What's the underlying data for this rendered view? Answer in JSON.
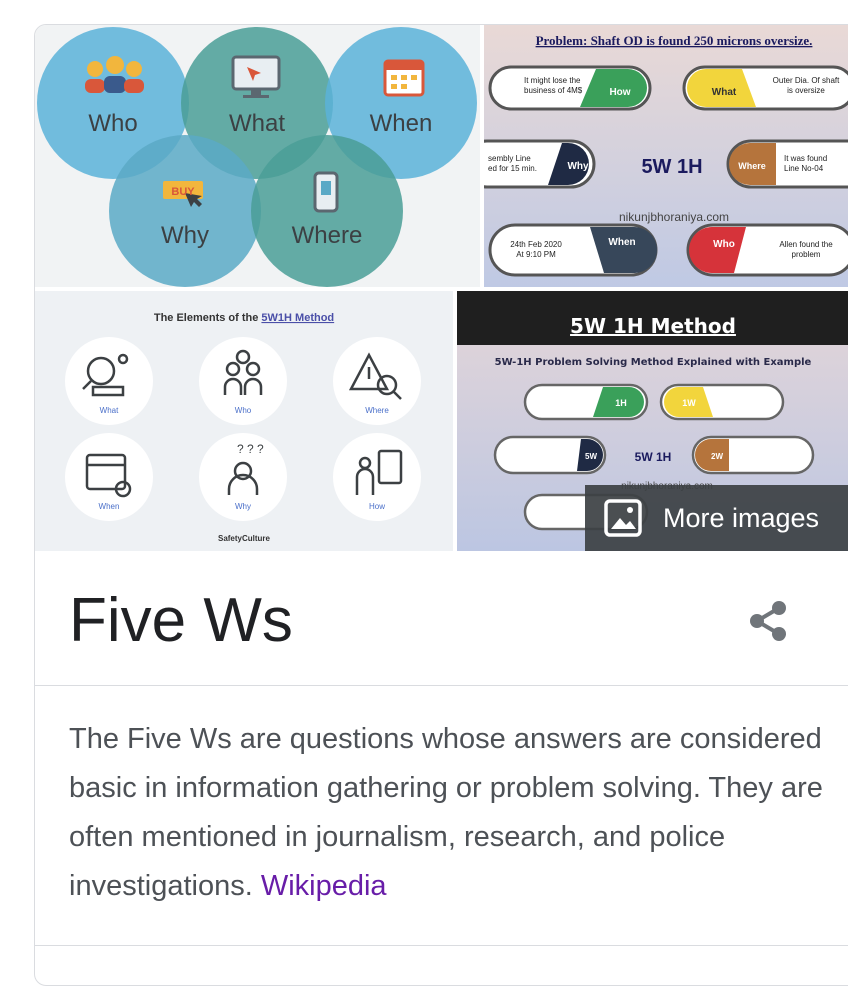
{
  "images": {
    "image1": {
      "labels": [
        "Who",
        "What",
        "When",
        "Why",
        "Where"
      ],
      "buy_text": "BUY"
    },
    "image2": {
      "heading": "Problem: Shaft OD is found 250 microns oversize.",
      "center": "5W 1H",
      "watermark": "nikunjbhoraniya.com",
      "pills": {
        "how": {
          "tag": "How",
          "text_l1": "It might lose the",
          "text_l2": "business of 4M$"
        },
        "what": {
          "tag": "What",
          "text_l1": "Outer Dia. Of shaft",
          "text_l2": "is oversize"
        },
        "why": {
          "tag": "Why",
          "text_l1": "sembly Line",
          "text_l2": "ed for 15 min."
        },
        "where": {
          "tag": "Where",
          "text_l1": "It was found",
          "text_l2": "Line No-04"
        },
        "when": {
          "tag": "When",
          "text_l1": "24th Feb 2020",
          "text_l2": "At 9:10 PM"
        },
        "who": {
          "tag": "Who",
          "text_l1": "Allen found the",
          "text_l2": "problem"
        }
      }
    },
    "image3": {
      "heading_prefix": "The Elements of the ",
      "heading_highlight": "5W1H Method",
      "items": [
        "What",
        "Who",
        "Where",
        "When",
        "Why",
        "How"
      ],
      "brand": "SafetyCulture"
    },
    "image4": {
      "heading": "5W 1H Method",
      "subheading": "5W-1H Problem Solving Method Explained with Example",
      "center": "5W 1H",
      "watermark": "nikunjbhoraniya.com",
      "tags": {
        "h": "1H",
        "w": "1W",
        "sw": "5W",
        "tw": "2W"
      }
    }
  },
  "more_images": {
    "label": "More images"
  },
  "title": "Five Ws",
  "description": "The Five Ws are questions whose answers are considered basic in information gathering or problem solving. They are often mentioned in journalism, research, and police investigations.",
  "source_link": "Wikipedia",
  "colors": {
    "link": "#681da8",
    "teal": "#4fa3a5",
    "blue": "#5aa9d6"
  }
}
